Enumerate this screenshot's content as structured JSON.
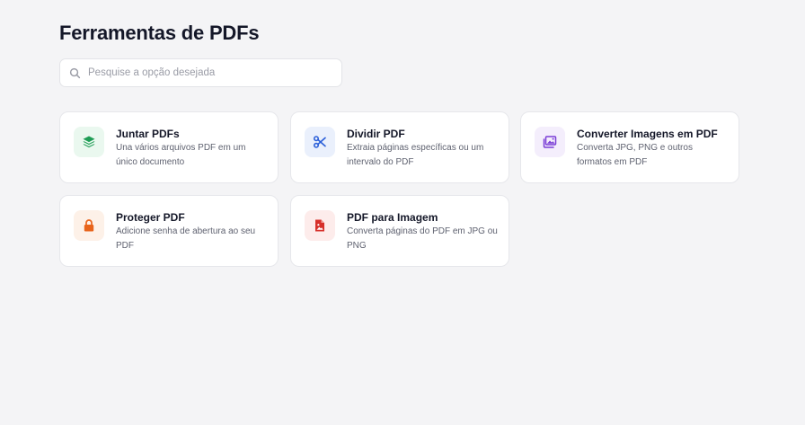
{
  "page_title": "Ferramentas de PDFs",
  "search": {
    "placeholder": "Pesquise a opção desejada",
    "value": ""
  },
  "tools": [
    {
      "title": "Juntar PDFs",
      "description": "Una vários arquivos PDF em um único documento",
      "icon": "layers-icon",
      "color": "#1f9d55",
      "bg": "#eaf8ef"
    },
    {
      "title": "Dividir PDF",
      "description": "Extraia páginas específicas ou um intervalo do PDF",
      "icon": "scissors-icon",
      "color": "#2b5fd9",
      "bg": "#eaf0fc"
    },
    {
      "title": "Converter Imagens em PDF",
      "description": "Converta JPG, PNG e outros formatos em PDF",
      "icon": "images-icon",
      "color": "#7b3fd6",
      "bg": "#f4eefc"
    },
    {
      "title": "Proteger PDF",
      "description": "Adicione senha de abertura ao seu PDF",
      "icon": "lock-icon",
      "color": "#e8641b",
      "bg": "#fdf1e8"
    },
    {
      "title": "PDF para Imagem",
      "description": "Converta páginas do PDF em JPG ou PNG",
      "icon": "file-image-icon",
      "color": "#d6302b",
      "bg": "#fdeceb"
    }
  ]
}
